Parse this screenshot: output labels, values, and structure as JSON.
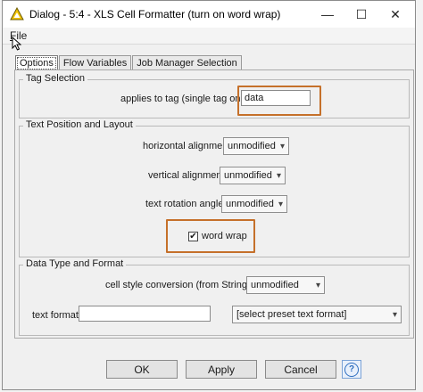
{
  "window": {
    "title": "Dialog - 5:4 - XLS Cell Formatter (turn on word wrap)",
    "minimize_glyph": "—",
    "maximize_glyph": "☐",
    "close_glyph": "✕"
  },
  "menu": {
    "file": "File"
  },
  "tabs": [
    {
      "label": "Options"
    },
    {
      "label": "Flow Variables"
    },
    {
      "label": "Job Manager Selection"
    }
  ],
  "tag_selection": {
    "title": "Tag Selection",
    "applies_label": "applies to tag (single tag only)",
    "tag_value": "data"
  },
  "text_position": {
    "title": "Text Position and Layout",
    "horizontal_label": "horizontal alignment",
    "horizontal_value": "unmodified",
    "vertical_label": "vertical alignment",
    "vertical_value": "unmodified",
    "rotation_label": "text rotation angle",
    "rotation_value": "unmodified",
    "word_wrap_label": "word wrap",
    "word_wrap_checked": true,
    "check_glyph": "✔"
  },
  "data_type": {
    "title": "Data Type and Format",
    "conversion_label": "cell style conversion (from String to)",
    "conversion_value": "unmodified",
    "text_format_label": "text format",
    "text_format_value": "",
    "preset_value": "[select preset text format]"
  },
  "buttons": {
    "ok": "OK",
    "apply": "Apply",
    "cancel": "Cancel",
    "help_glyph": "?"
  },
  "colors": {
    "highlight": "#c5702a",
    "title_icon": "#f2c400"
  },
  "icons": {
    "title": "knime-node-icon",
    "cursor": "mouse-pointer-icon",
    "dropdown": "chevron-down-icon"
  }
}
